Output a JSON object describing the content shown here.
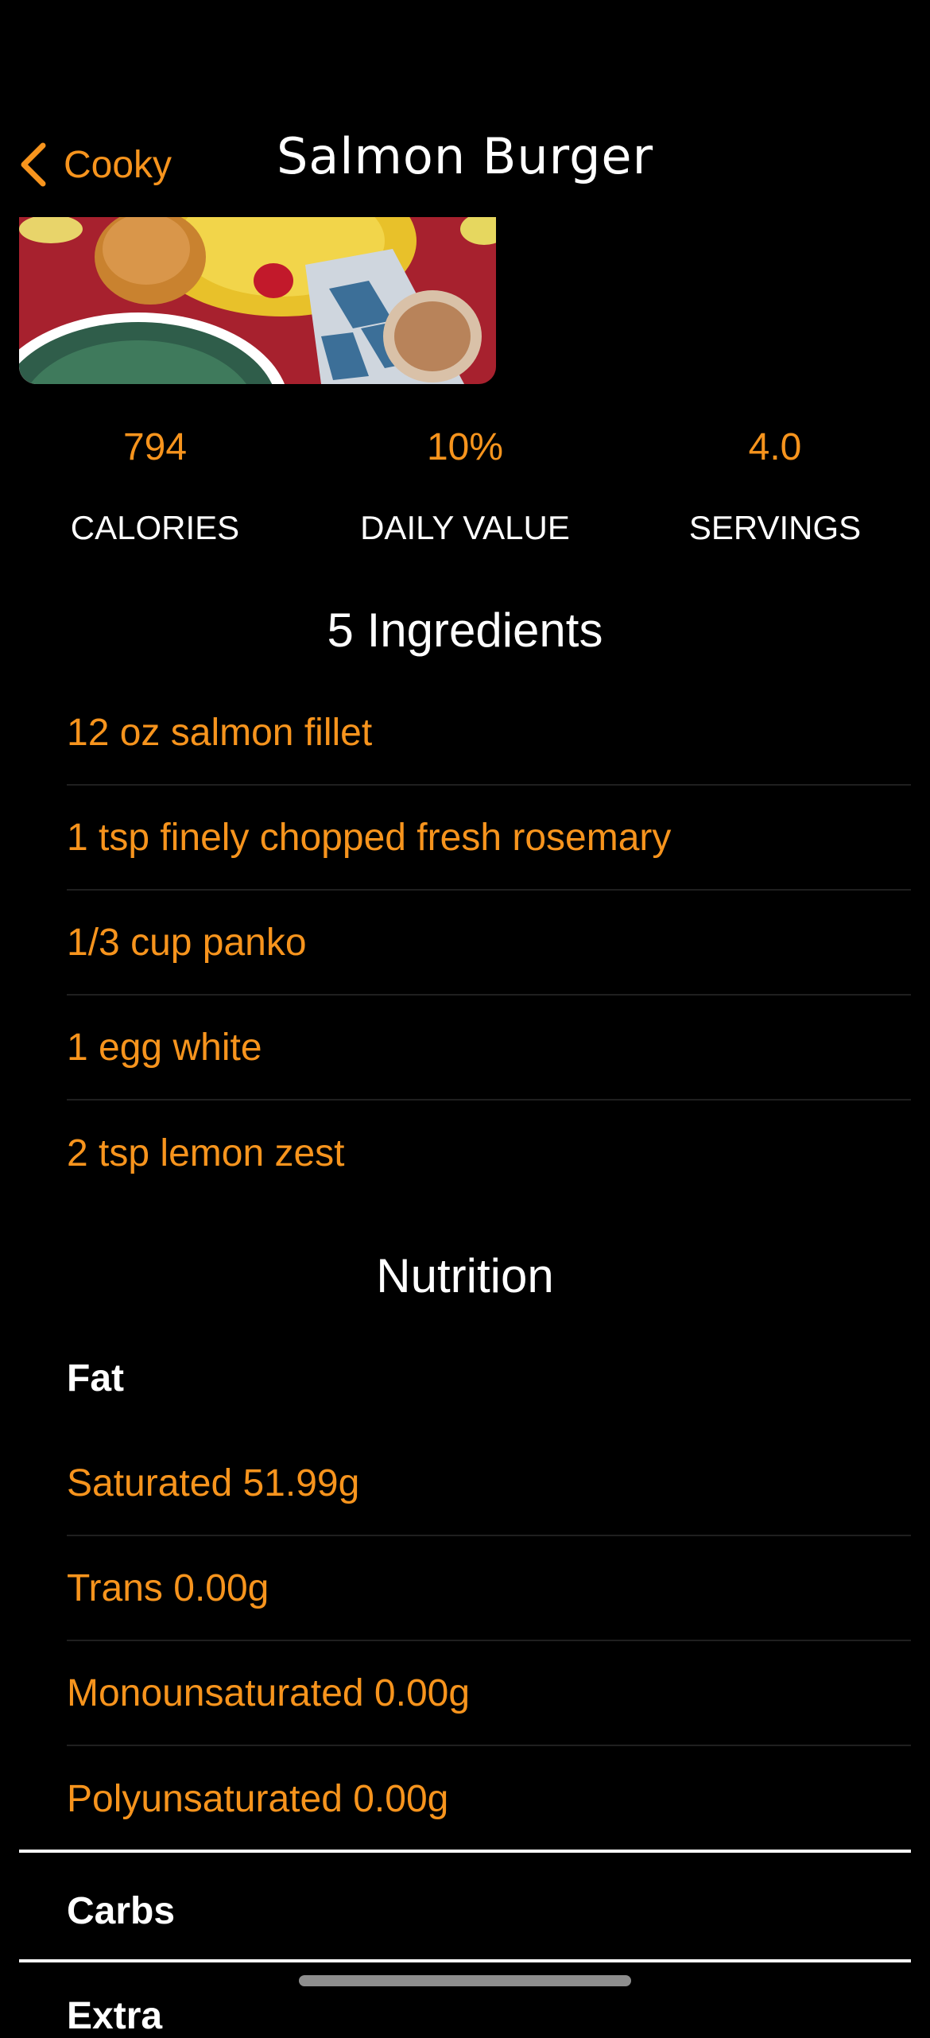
{
  "nav": {
    "back_label": "Cooky",
    "title": "Salmon Burger"
  },
  "hero": {
    "icon": "burger-photo"
  },
  "stats": [
    {
      "value": "794",
      "label": "CALORIES"
    },
    {
      "value": "10%",
      "label": "DAILY VALUE"
    },
    {
      "value": "4.0",
      "label": "SERVINGS"
    }
  ],
  "ingredients": {
    "title": "5 Ingredients",
    "items": [
      "12 oz salmon fillet",
      "1 tsp finely chopped fresh rosemary",
      "1/3 cup panko",
      "1 egg white",
      "2 tsp lemon zest"
    ]
  },
  "nutrition": {
    "title": "Nutrition",
    "groups": [
      {
        "label": "Fat",
        "items": [
          "Saturated 51.99g",
          "Trans 0.00g",
          "Monounsaturated 0.00g",
          "Polyunsaturated 0.00g"
        ]
      },
      {
        "label": "Carbs",
        "items": []
      },
      {
        "label": "Extra",
        "items": []
      }
    ]
  },
  "colors": {
    "accent": "#F7941D",
    "background": "#000000",
    "text": "#FFFFFF",
    "separator": "#1F1F1F"
  }
}
